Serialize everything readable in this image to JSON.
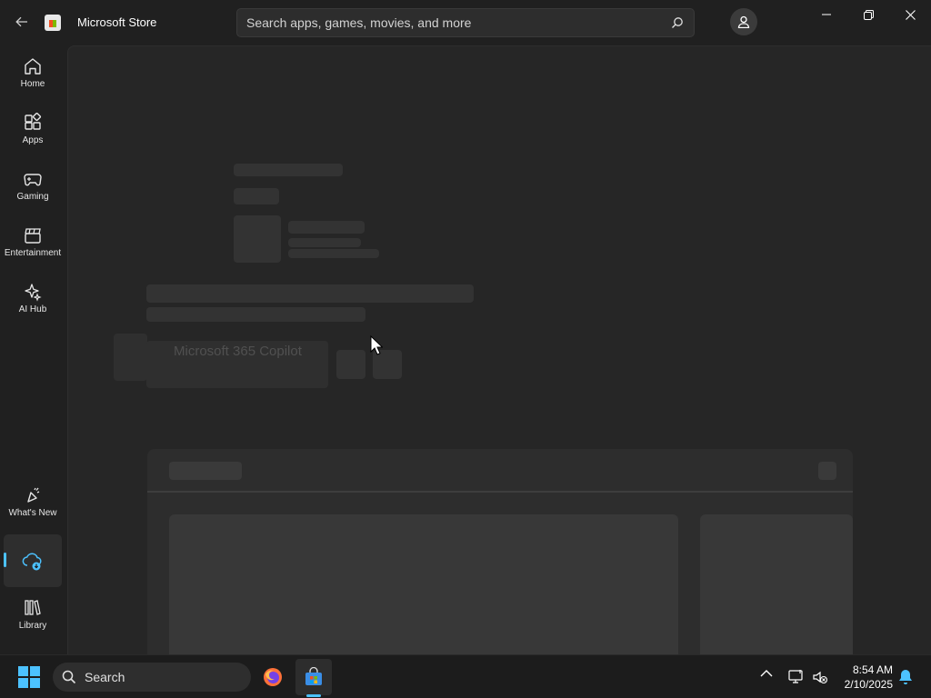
{
  "titlebar": {
    "app_title": "Microsoft Store",
    "search_placeholder": "Search apps, games, movies, and more"
  },
  "sidebar": {
    "items": [
      {
        "label": "Home",
        "icon": "home-icon"
      },
      {
        "label": "Apps",
        "icon": "apps-icon"
      },
      {
        "label": "Gaming",
        "icon": "gaming-icon"
      },
      {
        "label": "Entertainment",
        "icon": "entertainment-icon"
      },
      {
        "label": "AI Hub",
        "icon": "ai-hub-icon"
      }
    ],
    "bottom_items": [
      {
        "label": "What's New",
        "icon": "whats-new-icon"
      },
      {
        "label": "",
        "icon": "downloads-icon",
        "active": true
      },
      {
        "label": "Library",
        "icon": "library-icon"
      }
    ]
  },
  "main": {
    "overlay_text": "Microsoft 365 Copilot"
  },
  "taskbar": {
    "search_label": "Search",
    "time": "8:54 AM",
    "date": "2/10/2025"
  },
  "colors": {
    "accent": "#4cc2ff",
    "background": "#202020",
    "content": "#262626",
    "skeleton": "#333333"
  }
}
